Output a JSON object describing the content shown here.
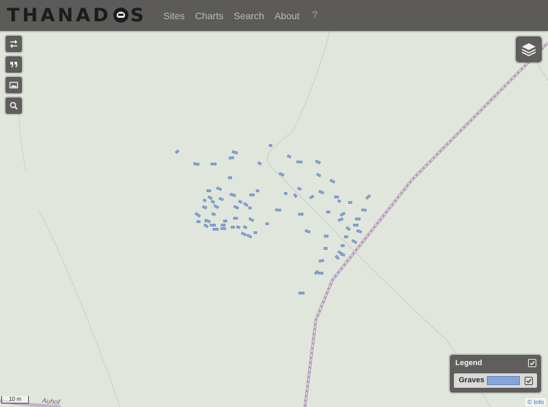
{
  "header": {
    "brand_pre": "THANAD",
    "brand_post": "S",
    "nav": [
      "Sites",
      "Charts",
      "Search",
      "About"
    ],
    "help": "?"
  },
  "map_tools": [
    "swap-icon",
    "quote-icon",
    "image-icon",
    "search-icon"
  ],
  "layer_switcher_icon": "layers-icon",
  "legend": {
    "title": "Legend",
    "items": [
      {
        "label": "Graves",
        "color": "#85a4d9",
        "checked": true
      }
    ],
    "checked": true
  },
  "scale_label": "10 m",
  "attribution": "© Info",
  "road_label": "Auhof",
  "colors": {
    "navbar": "#5c5b59",
    "map_background": "#e0e6db",
    "grave_fill": "#85a4d9",
    "grave_stroke": "#5e7fb8",
    "railway": "#b59ab9"
  }
}
